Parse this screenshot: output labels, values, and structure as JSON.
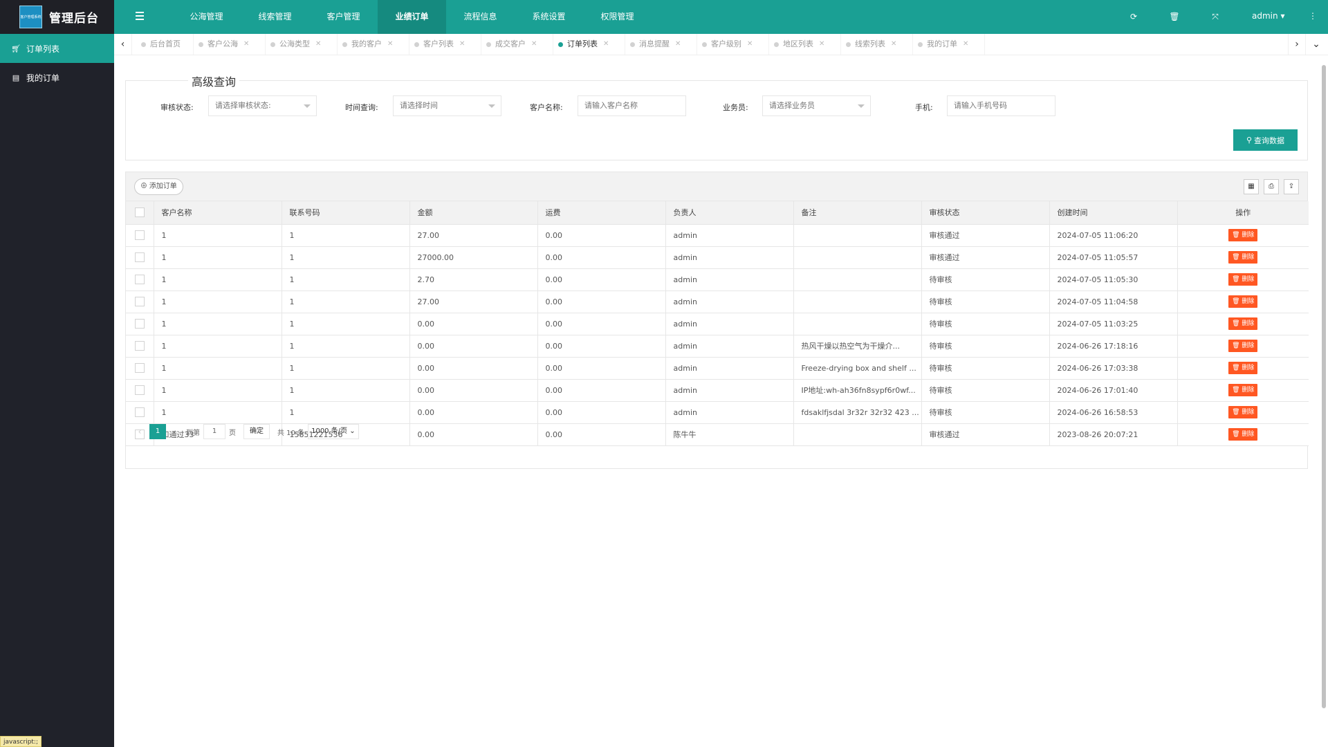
{
  "app": {
    "title": "管理后台",
    "logo_text": "客户管理系统"
  },
  "sidebar": {
    "items": [
      {
        "label": "订单列表",
        "icon": "cart-icon",
        "active": true
      },
      {
        "label": "我的订单",
        "icon": "print-icon",
        "active": false
      }
    ]
  },
  "header": {
    "nav": [
      "公海管理",
      "线索管理",
      "客户管理",
      "业绩订单",
      "流程信息",
      "系统设置",
      "权限管理"
    ],
    "active_nav": "业绩订单",
    "user": "admin"
  },
  "tabs": [
    "后台首页",
    "客户公海",
    "公海类型",
    "我的客户",
    "客户列表",
    "成交客户",
    "订单列表",
    "消息提醒",
    "客户级别",
    "地区列表",
    "线索列表",
    "我的订单"
  ],
  "active_tab": "订单列表",
  "search": {
    "legend": "高级查询",
    "audit_label": "审核状态:",
    "audit_placeholder": "请选择审核状态:",
    "time_label": "时间查询:",
    "time_placeholder": "请选择时间",
    "customer_label": "客户名称:",
    "customer_placeholder": "请输入客户名称",
    "sales_label": "业务员:",
    "sales_placeholder": "请选择业务员",
    "phone_label": "手机:",
    "phone_placeholder": "请输入手机号码",
    "query_button": "查询数据"
  },
  "table": {
    "add_button": "添加订单",
    "columns": [
      "客户名称",
      "联系号码",
      "金额",
      "运费",
      "负责人",
      "备注",
      "审核状态",
      "创建时间",
      "操作"
    ],
    "delete_label": "删除",
    "rows": [
      [
        "1",
        "1",
        "27.00",
        "0.00",
        "admin",
        "",
        "审核通过",
        "2024-07-05 11:06:20"
      ],
      [
        "1",
        "1",
        "27000.00",
        "0.00",
        "admin",
        "",
        "审核通过",
        "2024-07-05 11:05:57"
      ],
      [
        "1",
        "1",
        "2.70",
        "0.00",
        "admin",
        "",
        "待审核",
        "2024-07-05 11:05:30"
      ],
      [
        "1",
        "1",
        "27.00",
        "0.00",
        "admin",
        "",
        "待审核",
        "2024-07-05 11:04:58"
      ],
      [
        "1",
        "1",
        "0.00",
        "0.00",
        "admin",
        "",
        "待审核",
        "2024-07-05 11:03:25"
      ],
      [
        "1",
        "1",
        "0.00",
        "0.00",
        "admin",
        "热风干燥以热空气为干燥介...",
        "待审核",
        "2024-06-26 17:18:16"
      ],
      [
        "1",
        "1",
        "0.00",
        "0.00",
        "admin",
        "Freeze-drying box and shelf ...",
        "待审核",
        "2024-06-26 17:03:38"
      ],
      [
        "1",
        "1",
        "0.00",
        "0.00",
        "admin",
        "IP地址:wh-ah36fn8sypf6r0wf...",
        "待审核",
        "2024-06-26 17:01:40"
      ],
      [
        "1",
        "1",
        "0.00",
        "0.00",
        "admin",
        "fdsaklfjsdal 3r32r 32r32 423 ...",
        "待审核",
        "2024-06-26 16:58:53"
      ],
      [
        "和通过33",
        "15851221536",
        "0.00",
        "0.00",
        "陈牛牛",
        "",
        "审核通过",
        "2023-08-26 20:07:21"
      ]
    ]
  },
  "pager": {
    "current": "1",
    "goto_label": "到第",
    "page_input": "1",
    "page_label": "页",
    "confirm": "确定",
    "total": "共 10 条",
    "page_size": "1000 条/页"
  },
  "status_bar": "javascript:;",
  "colors": {
    "primary": "#1aa094",
    "sidebar": "#20222a",
    "danger": "#ff5722"
  }
}
